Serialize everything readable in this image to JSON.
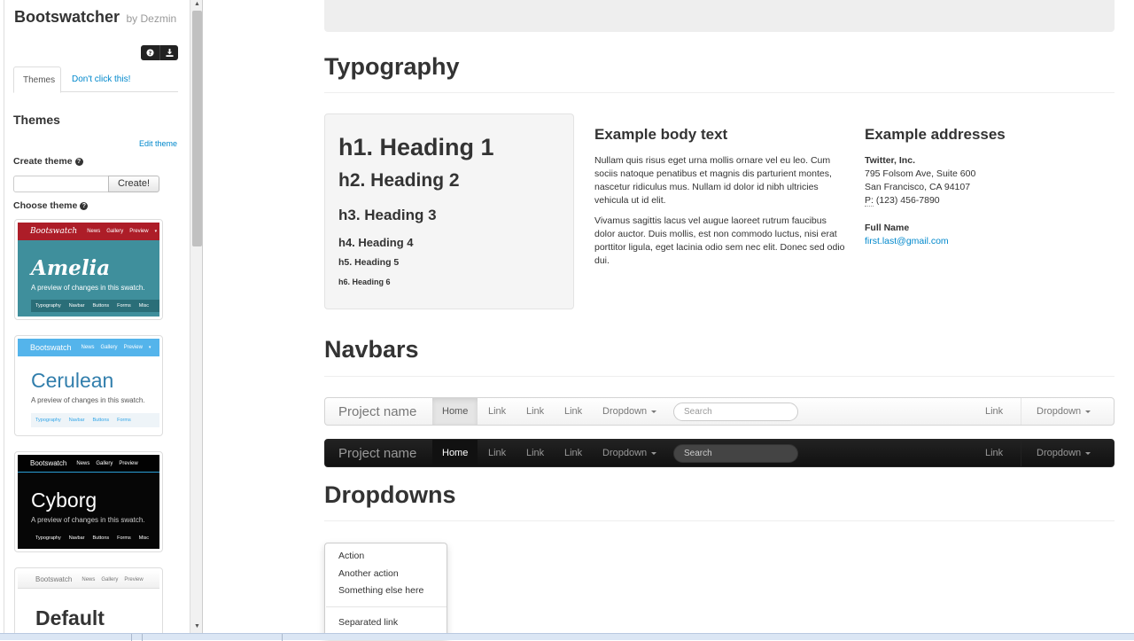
{
  "sidebar": {
    "brand": "Bootswatcher",
    "brand_by": "by Dezmin",
    "tabs": [
      "Themes",
      "Don't click this!"
    ],
    "heading": "Themes",
    "edit_theme": "Edit theme",
    "create_theme_label": "Create theme",
    "create_button": "Create!",
    "choose_theme_label": "Choose theme",
    "swatches": [
      {
        "name": "Amelia",
        "brand": "Bootswatch",
        "nav": [
          "News",
          "Gallery",
          "Preview"
        ],
        "desc": "A preview of changes in this swatch.",
        "tabs": [
          "Typography",
          "Navbar",
          "Buttons",
          "Forms",
          "Misc"
        ]
      },
      {
        "name": "Cerulean",
        "brand": "Bootswatch",
        "nav": [
          "News",
          "Gallery",
          "Preview"
        ],
        "desc": "A preview of changes in this swatch.",
        "tabs": [
          "Typography",
          "Navbar",
          "Buttons",
          "Forms"
        ]
      },
      {
        "name": "Cyborg",
        "brand": "Bootswatch",
        "nav": [
          "News",
          "Gallery",
          "Preview"
        ],
        "desc": "A preview of changes in this swatch.",
        "tabs": [
          "Typography",
          "Navbar",
          "Buttons",
          "Forms",
          "Misc"
        ]
      },
      {
        "name": "Default",
        "brand": "Bootswatch",
        "nav": [
          "News",
          "Gallery",
          "Preview"
        ]
      }
    ]
  },
  "typography": {
    "title": "Typography",
    "headings": [
      "h1. Heading 1",
      "h2. Heading 2",
      "h3. Heading 3",
      "h4. Heading 4",
      "h5. Heading 5",
      "h6. Heading 6"
    ],
    "body_title": "Example body text",
    "body_p1": "Nullam quis risus eget urna mollis ornare vel eu leo. Cum sociis natoque penatibus et magnis dis parturient montes, nascetur ridiculus mus. Nullam id dolor id nibh ultricies vehicula ut id elit.",
    "body_p2": "Vivamus sagittis lacus vel augue laoreet rutrum faucibus dolor auctor. Duis mollis, est non commodo luctus, nisi erat porttitor ligula, eget lacinia odio sem nec elit. Donec sed odio dui.",
    "addr_title": "Example addresses",
    "company": "Twitter, Inc.",
    "street": "795 Folsom Ave, Suite 600",
    "city": "San Francisco, CA 94107",
    "phone_label": "P:",
    "phone": "(123) 456-7890",
    "full_name": "Full Name",
    "email": "first.last@gmail.com"
  },
  "navbars": {
    "title": "Navbars",
    "brand": "Project name",
    "items": [
      "Home",
      "Link",
      "Link",
      "Link",
      "Dropdown"
    ],
    "search_placeholder": "Search",
    "right_link": "Link",
    "right_dropdown": "Dropdown"
  },
  "dropdowns": {
    "title": "Dropdowns",
    "items": [
      "Action",
      "Another action",
      "Something else here"
    ],
    "separated": "Separated link"
  },
  "colors": {
    "link": "#0088cc",
    "amelia": "#3f8f9c",
    "amelia_nav": "#ad1d28",
    "cerulean_nav": "#54b4eb",
    "cyborg": "#060606"
  }
}
